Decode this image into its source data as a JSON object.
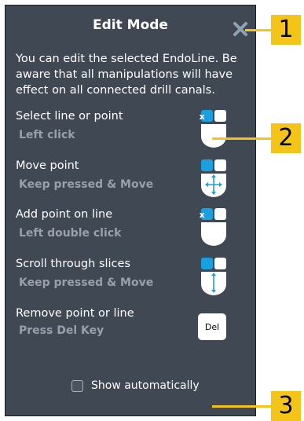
{
  "panel": {
    "title": "Edit Mode",
    "description": "You can edit the selected EndoLine. Be aware that all manipulations will have effect on all connected drill canals.",
    "close_icon": "close-x-icon",
    "show_automatically": {
      "label": "Show automatically",
      "checked": false
    }
  },
  "actions": [
    {
      "label": "Select line or point",
      "hint": "Left click",
      "icon": "mouse-left-click-icon",
      "badge": "1x"
    },
    {
      "label": "Move point",
      "hint": "Keep pressed & Move",
      "icon": "mouse-left-drag-move-icon",
      "badge": ""
    },
    {
      "label": "Add point on line",
      "hint": "Left double click",
      "icon": "mouse-left-double-click-icon",
      "badge": "2x"
    },
    {
      "label": "Scroll through slices",
      "hint": "Keep pressed & Move",
      "icon": "mouse-left-drag-scroll-icon",
      "badge": ""
    },
    {
      "label": "Remove point or line",
      "hint": "Press Del Key",
      "icon": "del-key-icon",
      "key": "Del"
    }
  ],
  "callouts": [
    "1",
    "2",
    "3"
  ],
  "colors": {
    "panel": "#404854",
    "accent": "#1a9fe0",
    "callout": "#f4c518"
  }
}
